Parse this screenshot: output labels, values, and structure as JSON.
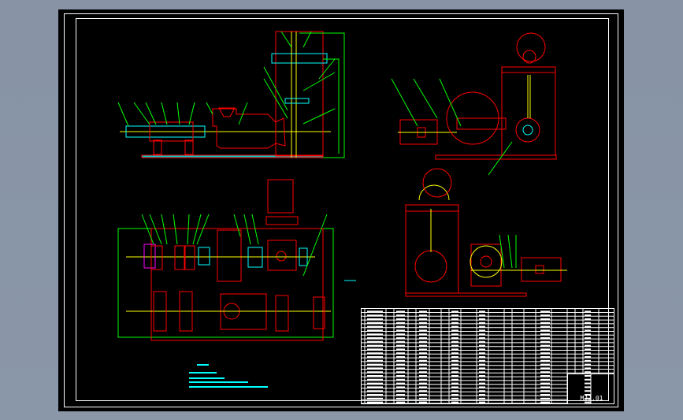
{
  "drawing": {
    "drawing_number": "MJJ.01",
    "views": [
      "front-section-view",
      "plan-view",
      "side-view-top",
      "side-view-bottom"
    ]
  },
  "colors": {
    "background": "#8a96a8",
    "sheet": "#000000",
    "border": "#ffffff",
    "outline": "#ff0000",
    "centerline": "#ffff00",
    "hatch": "#00ffff",
    "leader": "#00ff00",
    "highlight": "#ff00ff"
  }
}
